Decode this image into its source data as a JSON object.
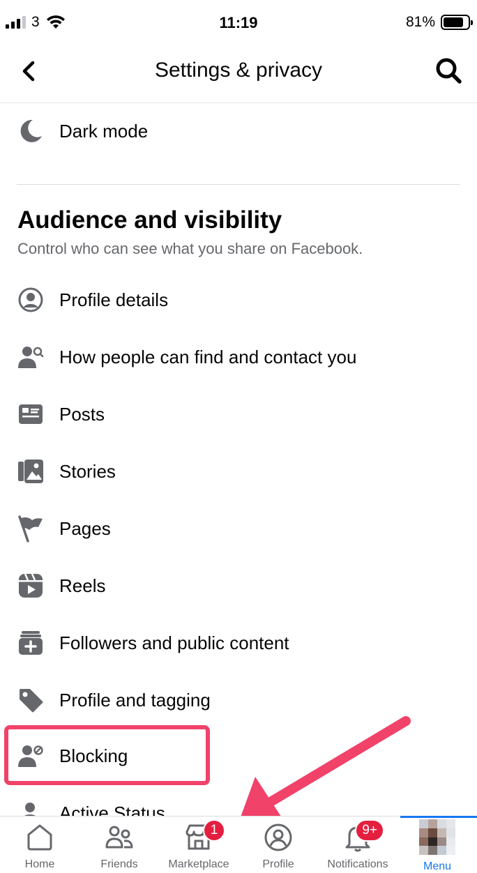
{
  "status": {
    "carrier": "3",
    "time": "11:19",
    "battery_pct": "81%",
    "battery_level": 0.81
  },
  "header": {
    "title": "Settings & privacy"
  },
  "items_top": [
    {
      "label": "Dark mode",
      "icon": "moon-icon"
    }
  ],
  "section": {
    "title": "Audience and visibility",
    "subtitle": "Control who can see what you share on Facebook.",
    "items": [
      {
        "label": "Profile details",
        "icon": "profile-circle-icon"
      },
      {
        "label": "How people can find and contact you",
        "icon": "person-search-icon"
      },
      {
        "label": "Posts",
        "icon": "posts-icon"
      },
      {
        "label": "Stories",
        "icon": "stories-icon"
      },
      {
        "label": "Pages",
        "icon": "flag-icon"
      },
      {
        "label": "Reels",
        "icon": "reels-icon"
      },
      {
        "label": "Followers and public content",
        "icon": "followers-icon"
      },
      {
        "label": "Profile and tagging",
        "icon": "tag-icon"
      },
      {
        "label": "Blocking",
        "icon": "block-person-icon"
      },
      {
        "label": "Active Status",
        "icon": "person-icon"
      }
    ]
  },
  "tabs": [
    {
      "label": "Home",
      "icon": "home-icon"
    },
    {
      "label": "Friends",
      "icon": "friends-icon"
    },
    {
      "label": "Marketplace",
      "icon": "marketplace-icon",
      "badge": "1"
    },
    {
      "label": "Profile",
      "icon": "profile-icon"
    },
    {
      "label": "Notifications",
      "icon": "bell-icon",
      "badge": "9+"
    },
    {
      "label": "Menu",
      "icon": "avatar",
      "active": true
    }
  ],
  "colors": {
    "accent": "#1877f2",
    "annotation": "#f1426a",
    "badge": "#e41e3f",
    "icon_gray": "#65676b"
  }
}
